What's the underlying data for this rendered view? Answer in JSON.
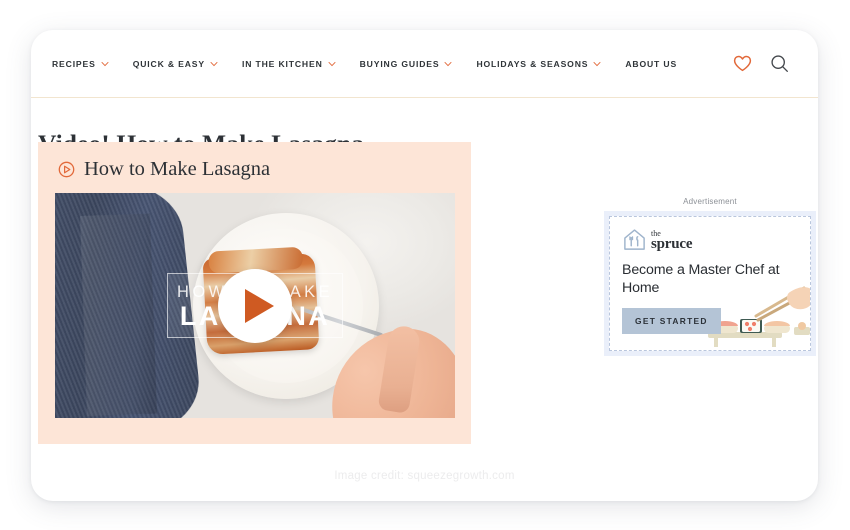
{
  "nav": {
    "items": [
      {
        "label": "RECIPES",
        "has_dropdown": true
      },
      {
        "label": "QUICK & EASY",
        "has_dropdown": true
      },
      {
        "label": "IN THE KITCHEN",
        "has_dropdown": true
      },
      {
        "label": "BUYING GUIDES",
        "has_dropdown": true
      },
      {
        "label": "HOLIDAYS & SEASONS",
        "has_dropdown": true
      },
      {
        "label": "ABOUT US",
        "has_dropdown": false
      }
    ],
    "icons": [
      {
        "name": "heart-icon",
        "color": "#e2693a"
      },
      {
        "name": "search-icon",
        "color": "#44484d"
      }
    ]
  },
  "article": {
    "title": "Video! How to Make Lasagna"
  },
  "video_card": {
    "play_icon": "play-circle-icon",
    "title": "How to Make Lasagna",
    "background_color": "#fde5d7",
    "thumbnail": {
      "overlay_line1": "HOW TO MAKE",
      "overlay_line2": "LASAGNA",
      "play_button": "play-button",
      "play_accent_color": "#cf5a22"
    }
  },
  "ad": {
    "label": "Advertisement",
    "brand_the": "the",
    "brand_name": "spruce",
    "logo_icon": "house-utensils-logo-icon",
    "headline": "Become a Master Chef at Home",
    "cta_label": "GET STARTED",
    "cta_color": "#b4c4d6",
    "art_icon": "sushi-chopsticks-illustration",
    "frame_color": "#eaeffa"
  },
  "footer": {
    "image_credit": "Image credit: squeezegrowth.com"
  },
  "theme": {
    "accent_orange": "#e2693a",
    "peach": "#fde5d7",
    "divider": "#f2e5cf",
    "text_dark": "#2d3136"
  }
}
